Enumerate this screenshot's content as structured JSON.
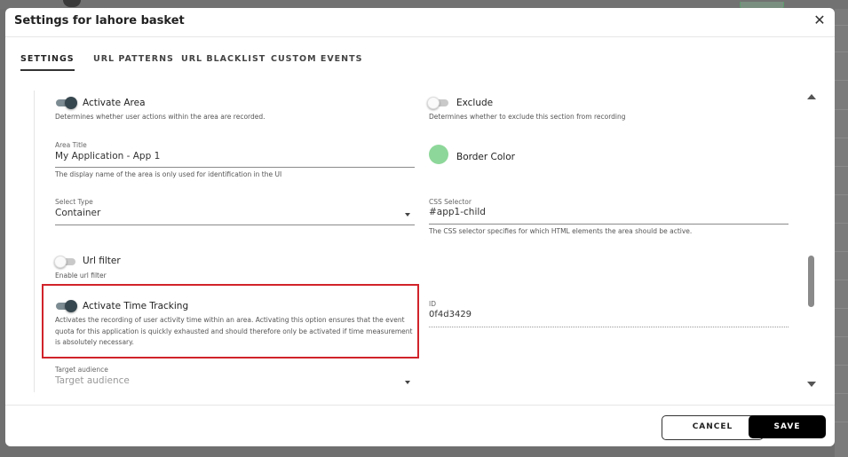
{
  "dialog": {
    "title": "Settings for lahore basket",
    "tabs": [
      "SETTINGS",
      "URL PATTERNS",
      "URL BLACKLIST",
      "CUSTOM EVENTS"
    ]
  },
  "form": {
    "activate_area": {
      "label": "Activate Area",
      "hint": "Determines whether user actions within the area are recorded.",
      "checked": true
    },
    "exclude": {
      "label": "Exclude",
      "hint": "Determines whether to exclude this section from recording",
      "checked": false
    },
    "area_title": {
      "label": "Area Title",
      "value": "My Application - App 1",
      "hint": "The display name of the area is only used for identification in the UI"
    },
    "border_color": {
      "label": "Border Color",
      "value": "#8ed79a"
    },
    "select_type": {
      "label": "Select Type",
      "value": "Container"
    },
    "css_selector": {
      "label": "CSS Selector",
      "value": "#app1-child",
      "hint": "The CSS selector specifies for which HTML elements the area should be active."
    },
    "url_filter": {
      "label": "Url filter",
      "hint": "Enable url filter",
      "checked": false
    },
    "time_tracking": {
      "label": "Activate Time Tracking",
      "hint": "Activates the recording of user activity time within an area. Activating this option ensures that the event quota for this application is quickly exhausted and should therefore only be activated if time measurement is absolutely necessary.",
      "checked": true
    },
    "id": {
      "label": "ID",
      "value": "0f4d3429"
    },
    "target_audience": {
      "label": "Target audience",
      "placeholder": "Target audience"
    }
  },
  "footer": {
    "cancel": "CANCEL",
    "save": "SAVE"
  },
  "colors": {
    "highlight": "#d1232a",
    "toggle_on": "#37474f",
    "swatch": "#8ed79a"
  },
  "icons": {
    "close": "close-icon",
    "dropdown": "caret-down-icon",
    "scroll_up": "scroll-up-icon",
    "scroll_down": "scroll-down-icon"
  }
}
